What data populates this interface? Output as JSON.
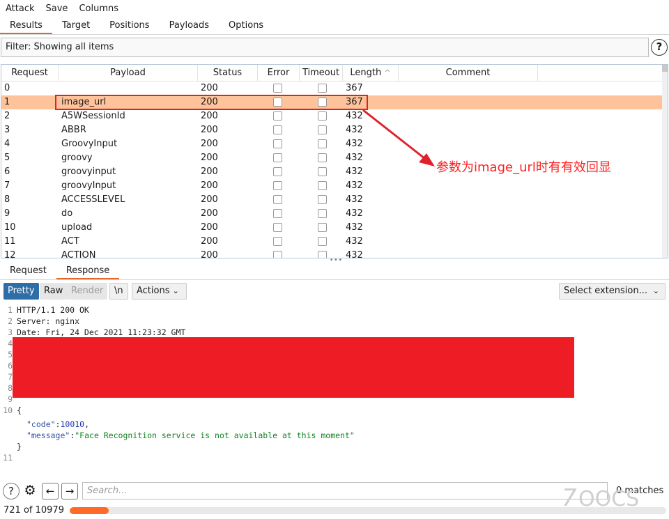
{
  "menu": [
    "Attack",
    "Save",
    "Columns"
  ],
  "top_tabs": [
    {
      "label": "Results",
      "active": true
    },
    {
      "label": "Target",
      "active": false
    },
    {
      "label": "Positions",
      "active": false
    },
    {
      "label": "Payloads",
      "active": false
    },
    {
      "label": "Options",
      "active": false
    }
  ],
  "filter_text": "Filter: Showing all items",
  "help_symbol": "?",
  "columns": [
    "Request",
    "Payload",
    "Status",
    "Error",
    "Timeout",
    "Length",
    "Comment"
  ],
  "sort_indicator": "^",
  "rows": [
    {
      "request": "0",
      "payload": "",
      "status": "200",
      "length": "367"
    },
    {
      "request": "1",
      "payload": "image_url",
      "status": "200",
      "length": "367",
      "highlight": true
    },
    {
      "request": "2",
      "payload": "A5WSessionId",
      "status": "200",
      "length": "432"
    },
    {
      "request": "3",
      "payload": "ABBR",
      "status": "200",
      "length": "432"
    },
    {
      "request": "4",
      "payload": "GroovyInput",
      "status": "200",
      "length": "432"
    },
    {
      "request": "5",
      "payload": "groovy",
      "status": "200",
      "length": "432"
    },
    {
      "request": "6",
      "payload": "groovyinput",
      "status": "200",
      "length": "432"
    },
    {
      "request": "7",
      "payload": "groovyInput",
      "status": "200",
      "length": "432"
    },
    {
      "request": "8",
      "payload": "ACCESSLEVEL",
      "status": "200",
      "length": "432"
    },
    {
      "request": "9",
      "payload": "do",
      "status": "200",
      "length": "432"
    },
    {
      "request": "10",
      "payload": "upload",
      "status": "200",
      "length": "432"
    },
    {
      "request": "11",
      "payload": "ACT",
      "status": "200",
      "length": "432"
    },
    {
      "request": "12",
      "payload": "ACTION",
      "status": "200",
      "length": "432"
    }
  ],
  "annotation": "参数为image_url时有有效回显",
  "highlight_color": "#fec39a",
  "annotation_color": "#ff2020",
  "bottom_tabs": [
    {
      "label": "Request",
      "active": false
    },
    {
      "label": "Response",
      "active": true
    }
  ],
  "view_buttons": {
    "pretty": "Pretty",
    "raw": "Raw",
    "render": "Render",
    "newline": "\\n",
    "actions": "Actions",
    "extension": "Select extension..."
  },
  "response_lines": [
    {
      "n": "1",
      "text": "HTTP/1.1 200 OK"
    },
    {
      "n": "2",
      "text": "Server: nginx"
    },
    {
      "n": "3",
      "text": "Date: Fri, 24 Dec 2021 11:23:32 GMT"
    },
    {
      "n": "4",
      "text": ""
    },
    {
      "n": "5",
      "text": ""
    },
    {
      "n": "6",
      "text": ""
    },
    {
      "n": "7",
      "text": ""
    },
    {
      "n": "8",
      "text": ""
    },
    {
      "n": "9",
      "text": ""
    },
    {
      "n": "10",
      "text": "{"
    }
  ],
  "json_body": {
    "code_key": "\"code\"",
    "code_val": "10010",
    "message_key": "\"message\"",
    "message_val": "\"Face Recognition service is not available at this moment\"",
    "close_brace": "}",
    "last_line_number": "11"
  },
  "search": {
    "placeholder": "Search...",
    "matches": "0 matches"
  },
  "status": {
    "counter": "721 of 10979",
    "progress_fraction": 0.066
  },
  "watermark": "7OOCS"
}
